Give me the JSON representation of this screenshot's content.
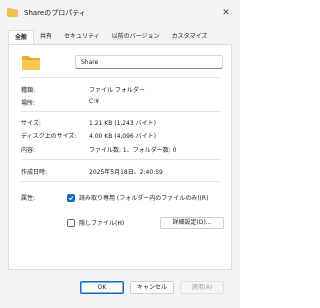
{
  "window": {
    "title": "Shareのプロパティ",
    "close_glyph": "✕"
  },
  "tabs": [
    {
      "label": "全般",
      "active": true
    },
    {
      "label": "共有",
      "active": false
    },
    {
      "label": "セキュリティ",
      "active": false
    },
    {
      "label": "以前のバージョン",
      "active": false
    },
    {
      "label": "カスタマイズ",
      "active": false
    }
  ],
  "general": {
    "name_value": "Share",
    "icon": "folder-icon",
    "rows": [
      {
        "label": "種類:",
        "value": "ファイル フォルダー"
      },
      {
        "label": "場所:",
        "value": "C:¥"
      },
      {
        "label": "サイズ:",
        "value": "1.21 KB (1,243 バイト)"
      },
      {
        "label": "ディスク上のサイズ:",
        "value": "4.00 KB (4,096 バイト)"
      },
      {
        "label": "内容:",
        "value": "ファイル数: 1、フォルダー数: 0"
      },
      {
        "label": "作成日時:",
        "value": "2025年5月18日、2:40:59"
      }
    ],
    "attributes": {
      "label": "属性:",
      "readonly_label": "読み取り専用 (フォルダー内のファイルのみ)(R)",
      "readonly_checked": true,
      "hidden_label": "隠しファイル(H)",
      "hidden_checked": false,
      "advanced_button": "詳細設定(D)..."
    }
  },
  "footer": {
    "ok": "OK",
    "cancel": "キャンセル",
    "apply": "適用(A)"
  },
  "colors": {
    "accent": "#1867c0",
    "folder": "#f4c04a"
  }
}
